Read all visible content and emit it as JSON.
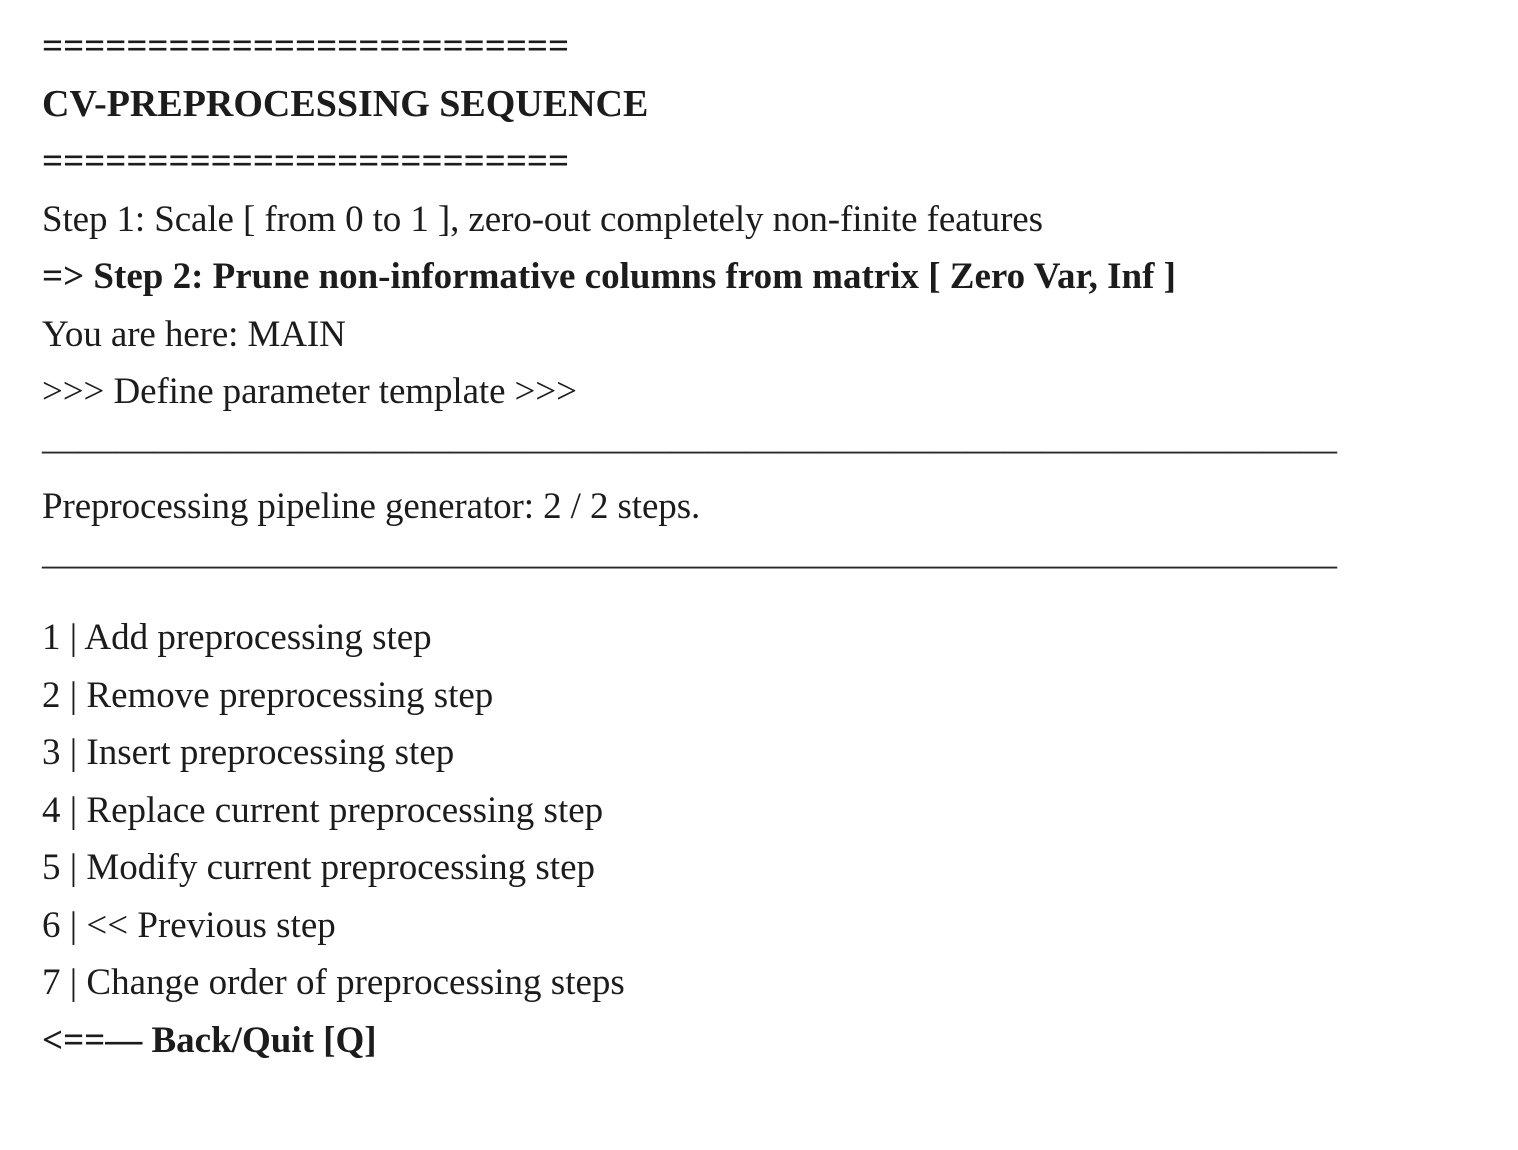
{
  "screen": {
    "kind": "text-terminal-menu",
    "background_color": "#ffffff",
    "text_color": "#1c1c1c"
  },
  "header": {
    "rule_top": "=========================",
    "title": "CV-PREPROCESSING SEQUENCE",
    "rule_bottom": "========================="
  },
  "pipeline": {
    "steps": [
      {
        "marker": "",
        "label": "Step 1: Scale [ from 0 to 1 ], zero-out completely non-finite features",
        "current": false
      },
      {
        "marker": "=> ",
        "label": "Step 2: Prune non-informative columns from matrix [ Zero Var, Inf ]",
        "current": true
      }
    ],
    "location_line": "You are here: MAIN",
    "section_banner": ">>> Define parameter template >>>",
    "separator": "———————————————————————————————————",
    "status_line": "Preprocessing pipeline generator: 2 / 2 steps."
  },
  "menu": {
    "items": [
      {
        "key": "1",
        "sep": " | ",
        "label": "Add preprocessing step"
      },
      {
        "key": "2",
        "sep": " | ",
        "label": "Remove preprocessing step"
      },
      {
        "key": "3",
        "sep": " | ",
        "label": "Insert preprocessing step"
      },
      {
        "key": "4",
        "sep": " | ",
        "label": "Replace current preprocessing step"
      },
      {
        "key": "5",
        "sep": " | ",
        "label": "Modify current preprocessing step"
      },
      {
        "key": "6",
        "sep": " | ",
        "label": "<< Previous step"
      },
      {
        "key": "7",
        "sep": " | ",
        "label": "Change order of preprocessing steps"
      }
    ],
    "back_quit": "<==— Back/Quit [Q]"
  },
  "lines": {
    "step_1_full": "Step 1: Scale [ from 0 to 1 ], zero-out completely non-finite features",
    "step_2_full": "=> Step 2: Prune non-informative columns from matrix [ Zero Var, Inf ]",
    "menu_1": "1 | Add preprocessing step",
    "menu_2": "2 | Remove preprocessing step",
    "menu_3": "3 | Insert preprocessing step",
    "menu_4": "4 | Replace current preprocessing step",
    "menu_5": "5 | Modify current preprocessing step",
    "menu_6": "6 | << Previous step",
    "menu_7": "7 | Change order of preprocessing steps"
  }
}
